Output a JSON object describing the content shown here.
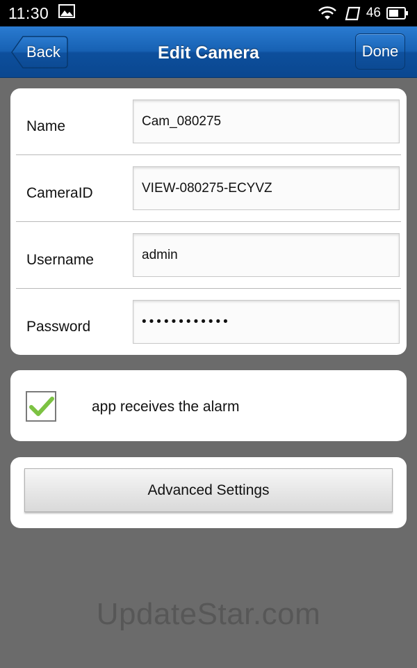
{
  "status_bar": {
    "time": "11:30",
    "signal_label": "46",
    "icons": [
      "gallery-icon",
      "wifi-icon",
      "cellular-icon",
      "battery-icon"
    ]
  },
  "nav": {
    "back_label": "Back",
    "title": "Edit Camera",
    "done_label": "Done",
    "color": "#1761b3"
  },
  "fields": [
    {
      "label": "Name",
      "value": "Cam_080275"
    },
    {
      "label": "CameraID",
      "value": "VIEW-080275-ECYVZ"
    },
    {
      "label": "Username",
      "value": "admin"
    },
    {
      "label": "Password",
      "value": "••••••••••••"
    }
  ],
  "alarm": {
    "label": "app receives the alarm",
    "checked": true,
    "check_color": "#7cc242"
  },
  "advanced_button": "Advanced Settings",
  "watermark": "UpdateStar.com"
}
